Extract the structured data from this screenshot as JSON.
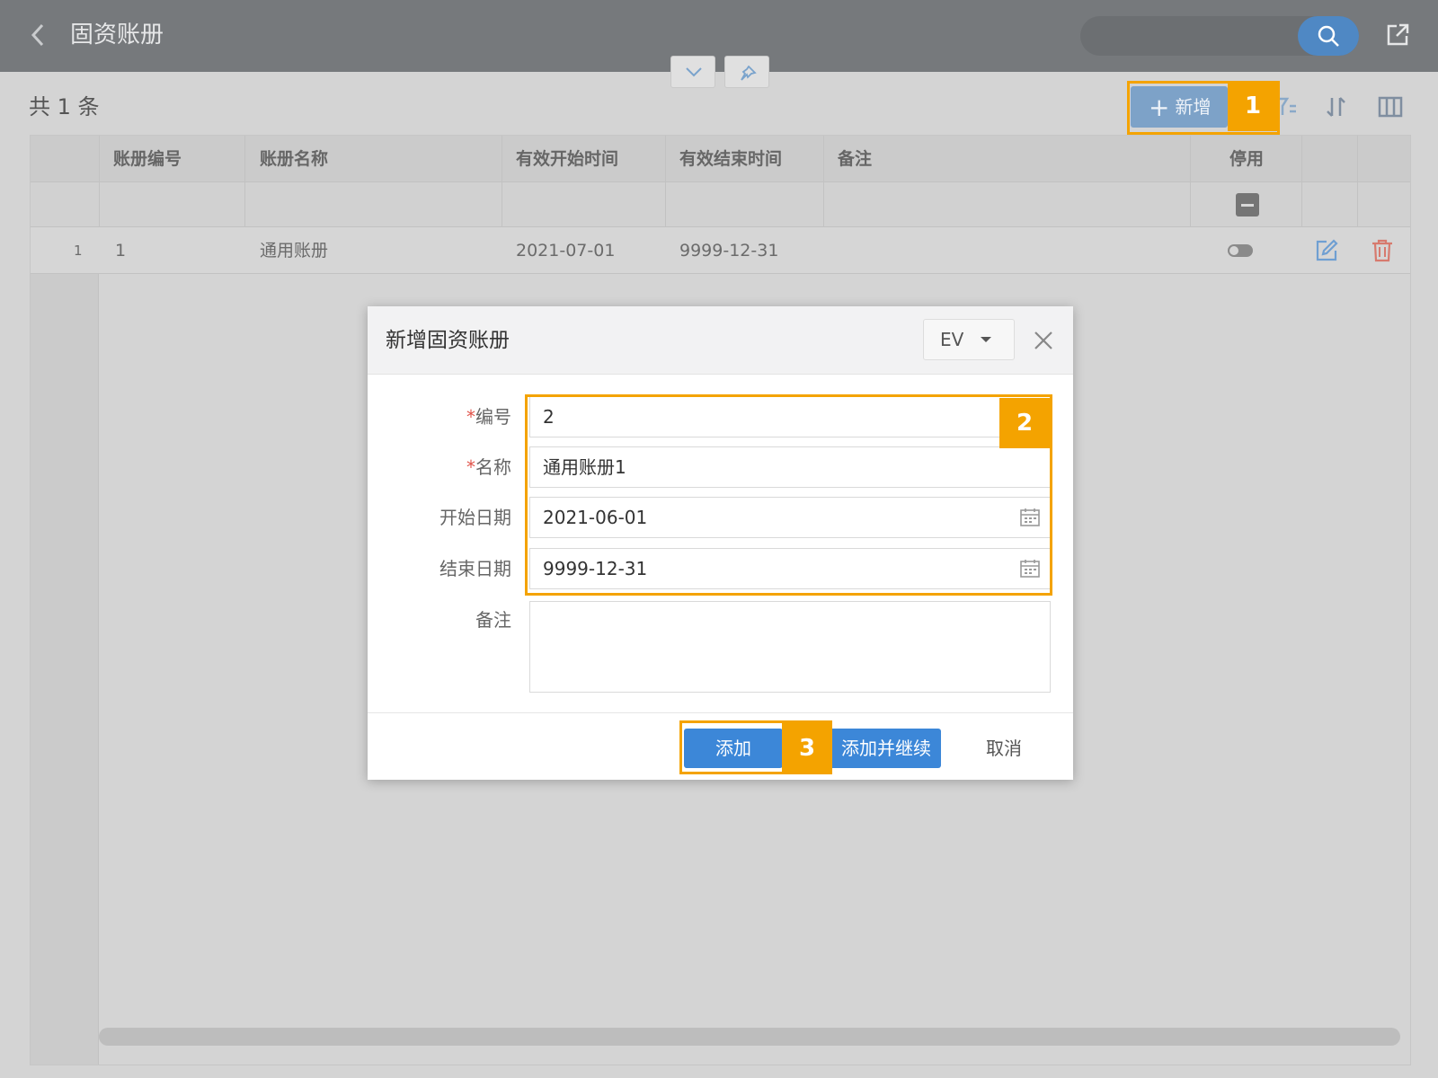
{
  "header": {
    "title": "固资账册",
    "search_placeholder": ""
  },
  "toolbar": {
    "count_text": "共 1 条",
    "add_label": "新增"
  },
  "table": {
    "columns": [
      "账册编号",
      "账册名称",
      "有效开始时间",
      "有效结束时间",
      "备注",
      "停用"
    ],
    "rows": [
      {
        "index": "1",
        "code": "1",
        "name": "通用账册",
        "start": "2021-07-01",
        "end": "9999-12-31",
        "remark": "",
        "disabled": false
      }
    ]
  },
  "dialog": {
    "title": "新增固资账册",
    "language": "EV",
    "fields": {
      "code_label": "编号",
      "code_value": "2",
      "name_label": "名称",
      "name_value": "通用账册1",
      "start_label": "开始日期",
      "start_value": "2021-06-01",
      "end_label": "结束日期",
      "end_value": "9999-12-31",
      "remark_label": "备注",
      "remark_value": ""
    },
    "buttons": {
      "add": "添加",
      "add_continue": "添加并继续",
      "cancel": "取消"
    }
  },
  "annotations": {
    "badge_1": "1",
    "badge_2": "2",
    "badge_3": "3",
    "highlight_color": "#f4a300"
  }
}
